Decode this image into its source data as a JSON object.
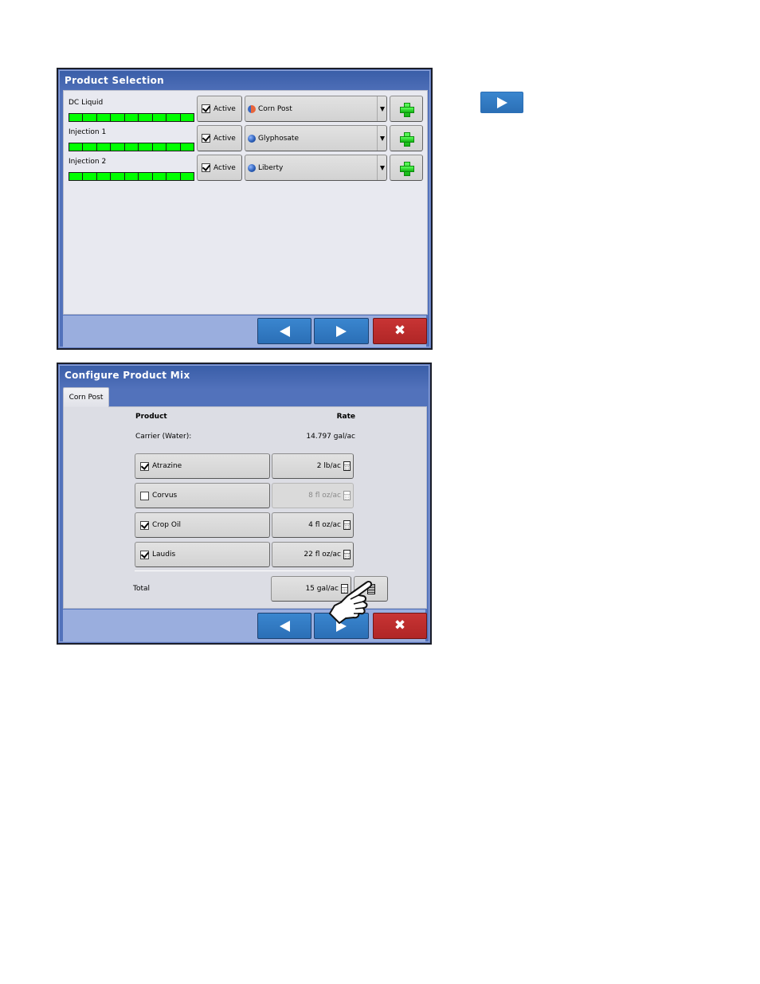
{
  "side_button": {
    "icon": "play-arrow-right"
  },
  "product_selection": {
    "title": "Product Selection",
    "channels": [
      {
        "name": "DC Liquid",
        "bar_segments": 9,
        "active_label": "Active",
        "active_checked": true,
        "product": "Corn Post",
        "product_icon": "mix-ball"
      },
      {
        "name": "Injection 1",
        "bar_segments": 9,
        "active_label": "Active",
        "active_checked": true,
        "product": "Glyphosate",
        "product_icon": "single-ball"
      },
      {
        "name": "Injection 2",
        "bar_segments": 9,
        "active_label": "Active",
        "active_checked": true,
        "product": "Liberty",
        "product_icon": "single-ball"
      }
    ],
    "footer": {
      "back": "arrow-left",
      "next": "arrow-right",
      "cancel": "close"
    }
  },
  "product_mix": {
    "title": "Configure Product Mix",
    "tab": "Corn Post",
    "col_product": "Product",
    "col_rate": "Rate",
    "carrier_label": "Carrier (Water):",
    "carrier_rate": "14.797 gal/ac",
    "products": [
      {
        "name": "Atrazine",
        "checked": true,
        "rate": "2 lb/ac",
        "enabled": true
      },
      {
        "name": "Corvus",
        "checked": false,
        "rate": "8 fl oz/ac",
        "enabled": false
      },
      {
        "name": "Crop Oil",
        "checked": true,
        "rate": "4 fl oz/ac",
        "enabled": true
      },
      {
        "name": "Laudis",
        "checked": true,
        "rate": "22 fl oz/ac",
        "enabled": true
      }
    ],
    "total_label": "Total",
    "total_rate": "15 gal/ac",
    "footer": {
      "back": "arrow-left",
      "next": "arrow-right",
      "cancel": "close"
    }
  },
  "pointer": "hand-pointer"
}
